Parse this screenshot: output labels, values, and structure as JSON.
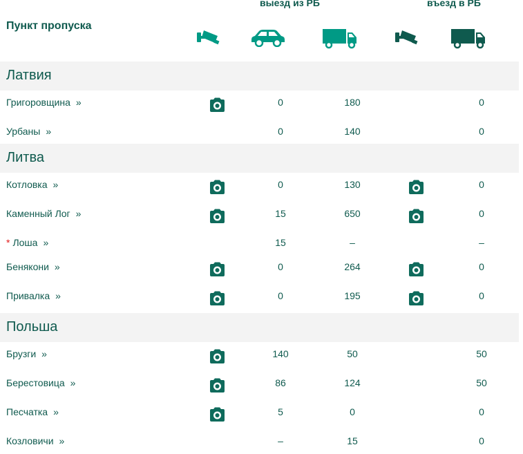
{
  "header": {
    "title": "Пункт пропуска",
    "exit_label": "выезд из РБ",
    "entry_label": "въезд в РБ",
    "icons": [
      "camera-cctv-icon",
      "car-icon",
      "truck-icon",
      "camera-cctv-icon",
      "truck-icon"
    ]
  },
  "colors": {
    "accent": "#0f5a4e",
    "accent_light": "#009a85",
    "section_bg": "#f3f3f3",
    "asterisk": "#e21b1b"
  },
  "sections": [
    {
      "title": "Латвия",
      "rows": [
        {
          "name": "Григоровщина",
          "cam_exit": true,
          "car": "0",
          "truck": "180",
          "cam_entry": false,
          "entry": "0"
        },
        {
          "name": "Урбаны",
          "cam_exit": false,
          "car": "0",
          "truck": "140",
          "cam_entry": false,
          "entry": "0"
        }
      ]
    },
    {
      "title": "Литва",
      "rows": [
        {
          "name": "Котловка",
          "cam_exit": true,
          "car": "0",
          "truck": "130",
          "cam_entry": true,
          "entry": "0"
        },
        {
          "name": "Каменный Лог",
          "cam_exit": true,
          "car": "15",
          "truck": "650",
          "cam_entry": true,
          "entry": "0"
        },
        {
          "name": "Лоша",
          "marker": "*",
          "cam_exit": false,
          "car": "15",
          "truck": "–",
          "cam_entry": false,
          "entry": "–"
        },
        {
          "name": "Бенякони",
          "cam_exit": true,
          "car": "0",
          "truck": "264",
          "cam_entry": true,
          "entry": "0"
        },
        {
          "name": "Привалка",
          "cam_exit": true,
          "car": "0",
          "truck": "195",
          "cam_entry": true,
          "entry": "0"
        }
      ]
    },
    {
      "title": "Польша",
      "rows": [
        {
          "name": "Брузги",
          "cam_exit": true,
          "car": "140",
          "truck": "50",
          "cam_entry": false,
          "entry": "50"
        },
        {
          "name": "Берестовица",
          "cam_exit": true,
          "car": "86",
          "truck": "124",
          "cam_entry": false,
          "entry": "50"
        },
        {
          "name": "Песчатка",
          "cam_exit": true,
          "car": "5",
          "truck": "0",
          "cam_entry": false,
          "entry": "0"
        },
        {
          "name": "Козловичи",
          "cam_exit": false,
          "car": "–",
          "truck": "15",
          "cam_entry": false,
          "entry": "0"
        }
      ]
    }
  ]
}
